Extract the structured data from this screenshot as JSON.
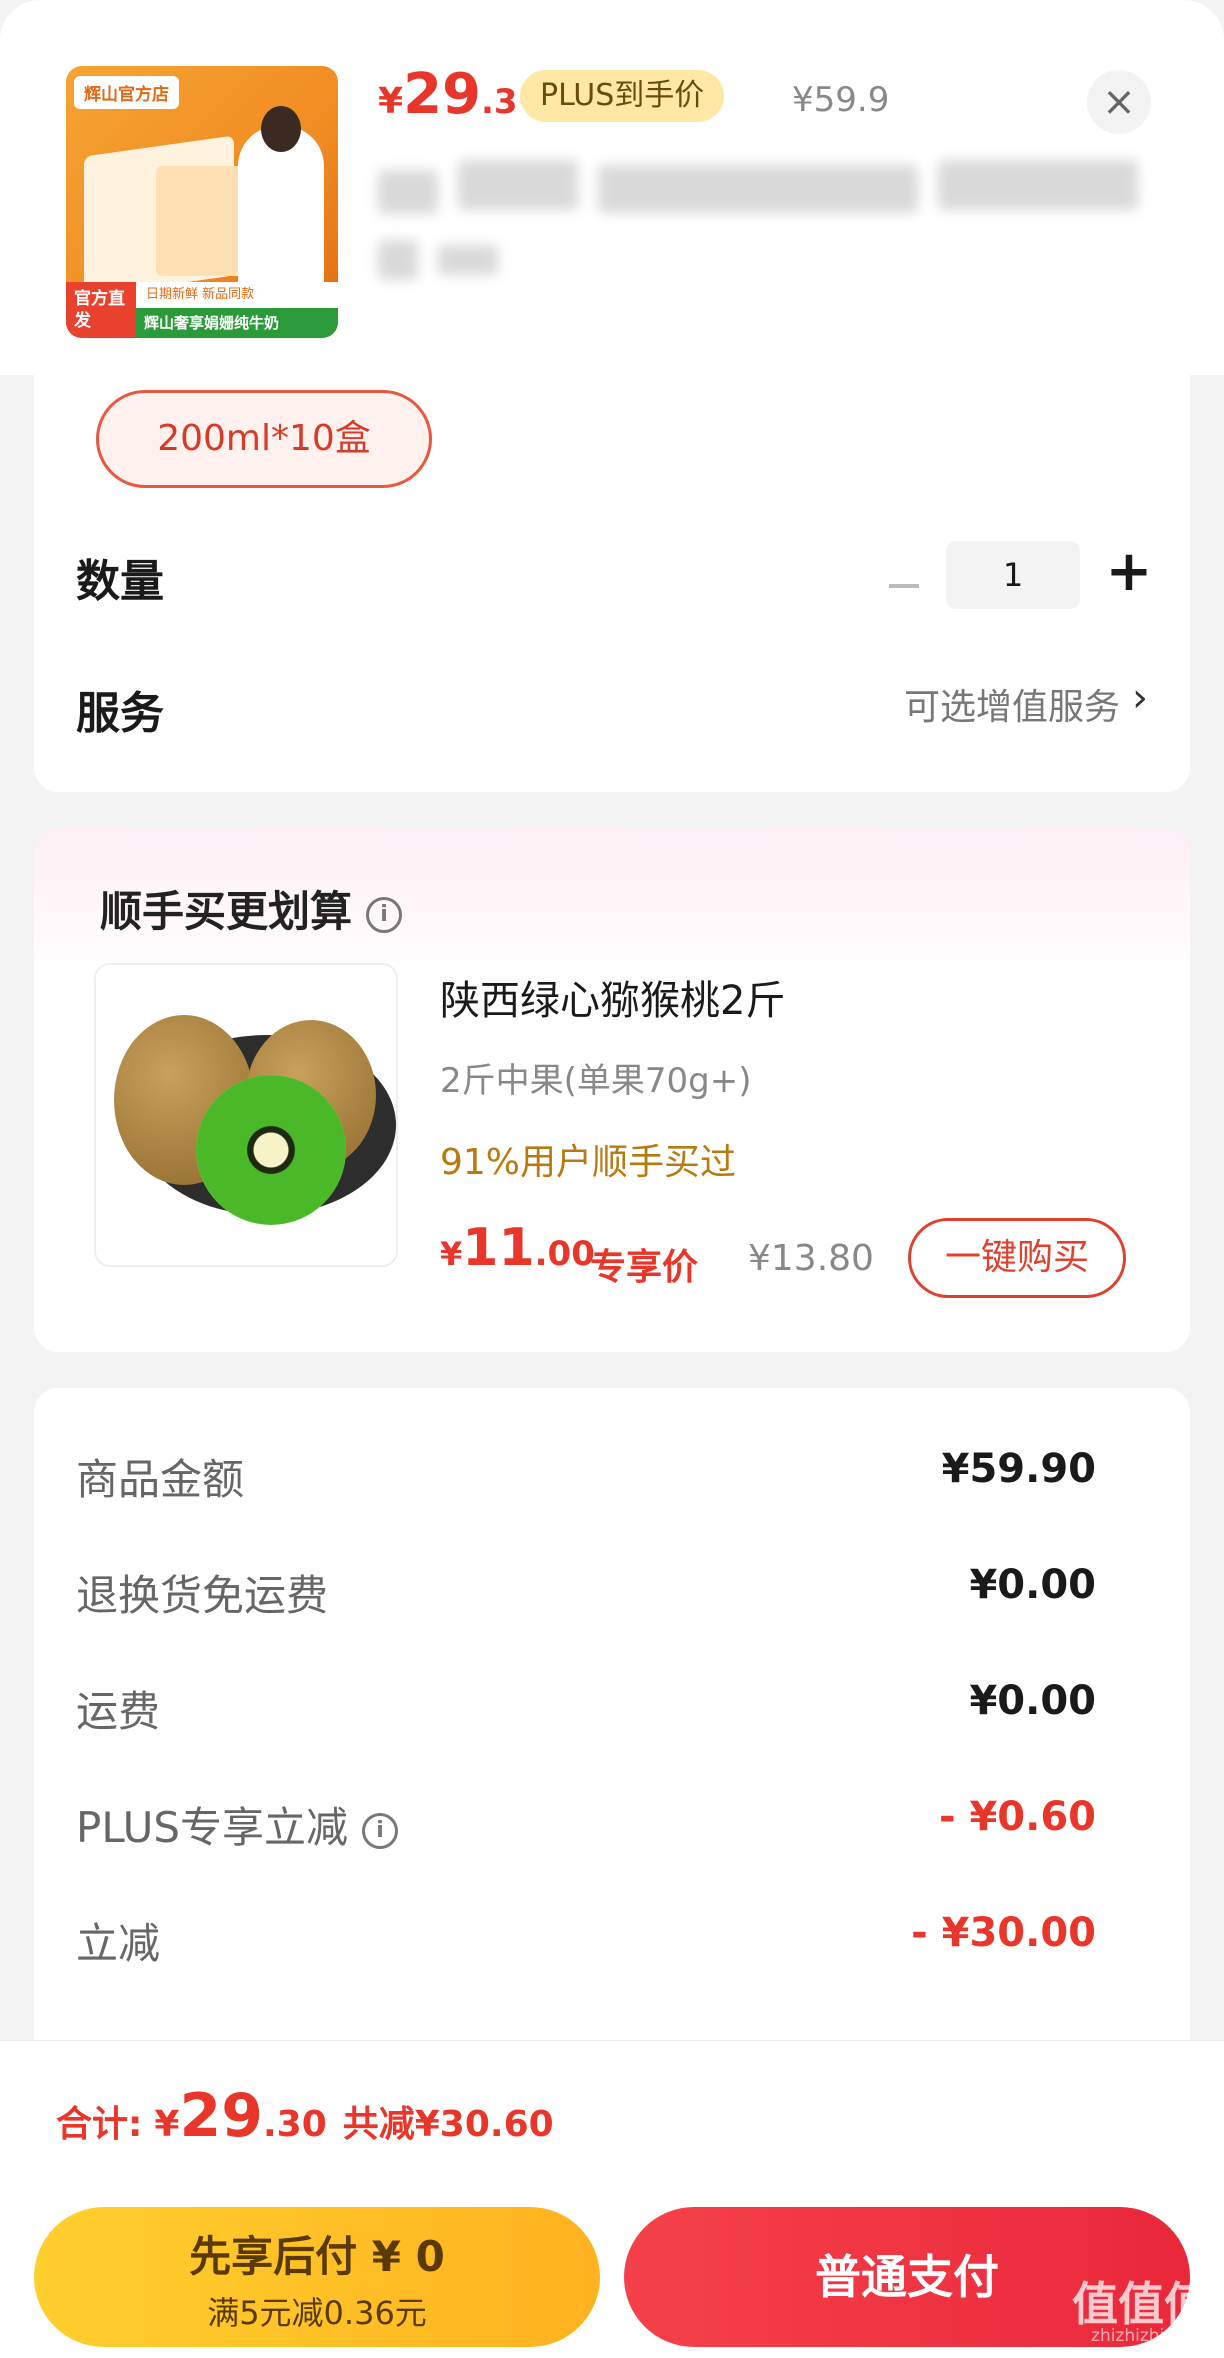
{
  "product": {
    "brand_label": "辉山官方店",
    "tag_label": "官方直发",
    "slogan_top": "日期新鲜 新品同款",
    "slogan": "辉山奢享娟姗纯牛奶",
    "price_currency": "¥",
    "price_int": "29",
    "price_dec": ".3",
    "plus_label": "PLUS到手价",
    "original_price": "¥59.9"
  },
  "close_icon": "×",
  "options": {
    "spec_selected": "200ml*10盒",
    "quantity_label": "数量",
    "quantity_value": "1",
    "minus_symbol": "−",
    "plus_symbol": "+",
    "service_label": "服务",
    "service_value": "可选增值服务",
    "chevron": "›"
  },
  "bundle": {
    "title": "顺手买更划算",
    "info_icon": "i",
    "item_name": "陕西绿心猕猴桃2斤",
    "item_spec": "2斤中果(单果70g+)",
    "item_stat": "91%用户顺手买过",
    "price_currency": "¥",
    "price_int": "11",
    "price_dec": ".00",
    "price_label": "专享价",
    "original_price": "¥13.80",
    "buy_button": "一键购买"
  },
  "summary": {
    "rows": [
      {
        "label": "商品金额",
        "value": "¥59.90",
        "red": false
      },
      {
        "label": "退换货免运费",
        "value": "¥0.00",
        "red": false
      },
      {
        "label": "运费",
        "value": "¥0.00",
        "red": false
      },
      {
        "label": "PLUS专享立减",
        "value": "- ¥0.60",
        "red": true
      },
      {
        "label": "立减",
        "value": "- ¥30.00",
        "red": true
      }
    ],
    "info_icon": "i"
  },
  "bottom": {
    "total_label": "合计:",
    "total_currency": "¥",
    "total_int": "29",
    "total_dec": ".30",
    "total_saved": "共减¥30.60",
    "later_button_line1": "先享后付 ¥ 0",
    "later_button_line2": "满5元减0.36元",
    "pay_button": "普通支付"
  },
  "watermark": {
    "main": "值值值",
    "sub": "zhizhizhi.com"
  },
  "colors": {
    "accent_red": "#e8362a",
    "plus_gold": "#ffe7a6",
    "pay_button": "#e9283a",
    "later_button": "#ffb21f"
  }
}
